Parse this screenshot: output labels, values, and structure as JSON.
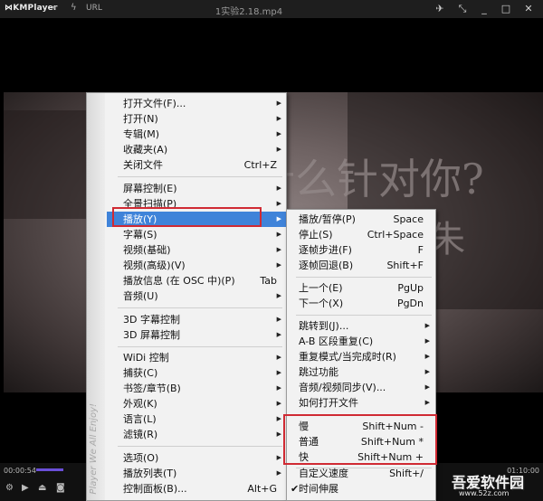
{
  "app": {
    "logo": "KMPlayer",
    "url_label": "URL",
    "file_title": "1实验2.18.mp4"
  },
  "titlebar_icons": [
    "pin-icon",
    "restore-icon",
    "minimize-icon",
    "maximize-icon",
    "close-icon"
  ],
  "controls": {
    "time": "00:00:54",
    "right_time": "01:10:00",
    "progress": 0.07
  },
  "video_text": {
    "line1": "为什么针对你?",
    "line2": "朱"
  },
  "main_menu": {
    "strip_text": "Player We All Enjoy!",
    "items": [
      {
        "label": "打开文件(F)...",
        "shortcut": "",
        "arrow": true
      },
      {
        "label": "打开(N)",
        "shortcut": "",
        "arrow": true
      },
      {
        "label": "专辑(M)",
        "shortcut": "",
        "arrow": true
      },
      {
        "label": "收藏夹(A)",
        "shortcut": "",
        "arrow": true
      },
      {
        "label": "关闭文件",
        "shortcut": "Ctrl+Z",
        "arrow": false
      },
      {
        "label": "屏幕控制(E)",
        "shortcut": "",
        "arrow": true
      },
      {
        "label": "全景扫描(P)",
        "shortcut": "",
        "arrow": true
      },
      {
        "label": "播放(Y)",
        "shortcut": "",
        "arrow": true
      },
      {
        "label": "字幕(S)",
        "shortcut": "",
        "arrow": true
      },
      {
        "label": "视频(基础)",
        "shortcut": "",
        "arrow": true
      },
      {
        "label": "视频(高级)(V)",
        "shortcut": "",
        "arrow": true
      },
      {
        "label": "播放信息 (在 OSC 中)(P)",
        "shortcut": "Tab",
        "arrow": false
      },
      {
        "label": "音频(U)",
        "shortcut": "",
        "arrow": true
      },
      {
        "label": "3D 字幕控制",
        "shortcut": "",
        "arrow": true
      },
      {
        "label": "3D 屏幕控制",
        "shortcut": "",
        "arrow": true
      },
      {
        "label": "WiDi 控制",
        "shortcut": "",
        "arrow": true
      },
      {
        "label": "捕获(C)",
        "shortcut": "",
        "arrow": true
      },
      {
        "label": "书签/章节(B)",
        "shortcut": "",
        "arrow": true
      },
      {
        "label": "外观(K)",
        "shortcut": "",
        "arrow": true
      },
      {
        "label": "语言(L)",
        "shortcut": "",
        "arrow": true
      },
      {
        "label": "滤镜(R)",
        "shortcut": "",
        "arrow": true
      },
      {
        "label": "选项(O)",
        "shortcut": "",
        "arrow": true
      },
      {
        "label": "播放列表(T)",
        "shortcut": "",
        "arrow": true
      },
      {
        "label": "控制面板(B)...",
        "shortcut": "Alt+G",
        "arrow": false
      }
    ]
  },
  "play_submenu": {
    "items": [
      {
        "label": "播放/暂停(P)",
        "shortcut": "Space",
        "arrow": false,
        "checked": false
      },
      {
        "label": "停止(S)",
        "shortcut": "Ctrl+Space",
        "arrow": false,
        "checked": false
      },
      {
        "label": "逐帧步进(F)",
        "shortcut": "F",
        "arrow": false,
        "checked": false
      },
      {
        "label": "逐帧回退(B)",
        "shortcut": "Shift+F",
        "arrow": false,
        "checked": false
      },
      {
        "label": "上一个(E)",
        "shortcut": "PgUp",
        "arrow": false,
        "checked": false
      },
      {
        "label": "下一个(X)",
        "shortcut": "PgDn",
        "arrow": false,
        "checked": false
      },
      {
        "label": "跳转到(J)...",
        "shortcut": "",
        "arrow": true,
        "checked": false
      },
      {
        "label": "A-B 区段重复(C)",
        "shortcut": "",
        "arrow": true,
        "checked": false
      },
      {
        "label": "重复模式/当完成时(R)",
        "shortcut": "",
        "arrow": true,
        "checked": false
      },
      {
        "label": "跳过功能",
        "shortcut": "",
        "arrow": true,
        "checked": false
      },
      {
        "label": "音频/视频同步(V)...",
        "shortcut": "",
        "arrow": true,
        "checked": false
      },
      {
        "label": "如何打开文件",
        "shortcut": "",
        "arrow": true,
        "checked": false
      },
      {
        "label": "慢",
        "shortcut": "Shift+Num -",
        "arrow": false,
        "checked": false
      },
      {
        "label": "普通",
        "shortcut": "Shift+Num *",
        "arrow": false,
        "checked": false
      },
      {
        "label": "快",
        "shortcut": "Shift+Num +",
        "arrow": false,
        "checked": false
      },
      {
        "label": "自定义速度",
        "shortcut": "Shift+/",
        "arrow": false,
        "checked": false
      },
      {
        "label": "时间伸展",
        "shortcut": "",
        "arrow": false,
        "checked": true
      }
    ]
  },
  "watermark": {
    "brand": "吾爱软件园",
    "domain": "www.52z.com"
  }
}
